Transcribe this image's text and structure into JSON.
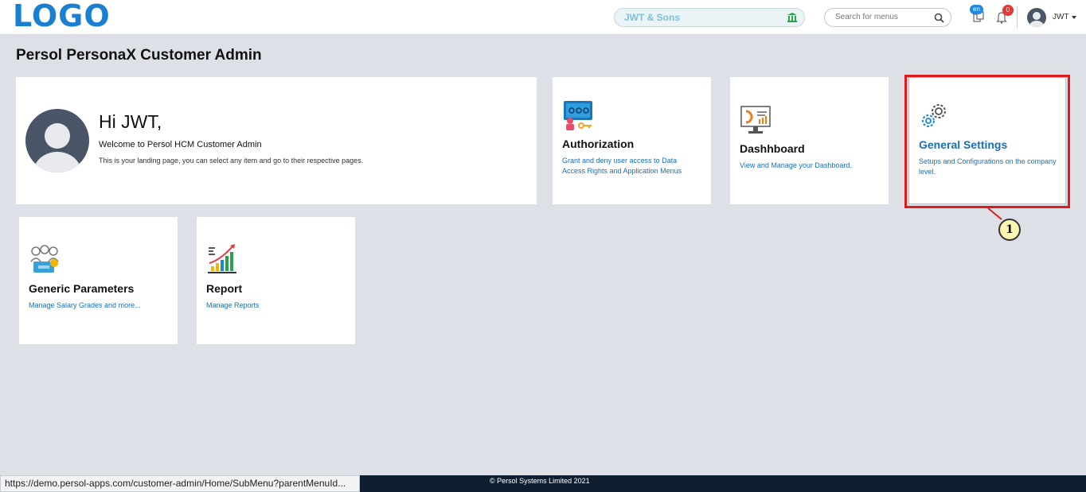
{
  "header": {
    "logo": "LOGO",
    "company": "JWT & Sons",
    "search_placeholder": "Search for menus",
    "language_badge": "en",
    "notification_count": "0",
    "user_name": "JWT"
  },
  "page": {
    "title": "Persol PersonaX Customer Admin"
  },
  "welcome": {
    "greeting": "Hi JWT,",
    "subtitle": "Welcome to Persol HCM Customer Admin",
    "description": "This is your landing page, you can select any item and go to their respective pages."
  },
  "tiles": [
    {
      "title": "Authorization",
      "description": "Grant and deny user access to Data Access Rights and Application Menus",
      "icon": "authorization-icon"
    },
    {
      "title": "Dashhboard",
      "description": "View and Manage your Dashboard.",
      "icon": "dashboard-icon"
    },
    {
      "title": "General Settings",
      "description": "Setups and Configurations on the company level.",
      "icon": "settings-gears-icon"
    },
    {
      "title": "Generic Parameters",
      "description": "Manage Salary Grades and more...",
      "icon": "parameters-people-icon"
    },
    {
      "title": "Report",
      "description": "Manage Reports",
      "icon": "report-chart-icon"
    }
  ],
  "annotation": {
    "callout_number": "1",
    "highlight_color": "#e01b1b"
  },
  "footer": {
    "copyright": "© Persol Systems Limited 2021",
    "status_url": "https://demo.persol-apps.com/customer-admin/Home/SubMenu?parentMenuId..."
  },
  "colors": {
    "accent": "#1a7fd0",
    "link": "#1a6fb5",
    "background": "#dde1e7",
    "footer": "#0f1e2e"
  }
}
